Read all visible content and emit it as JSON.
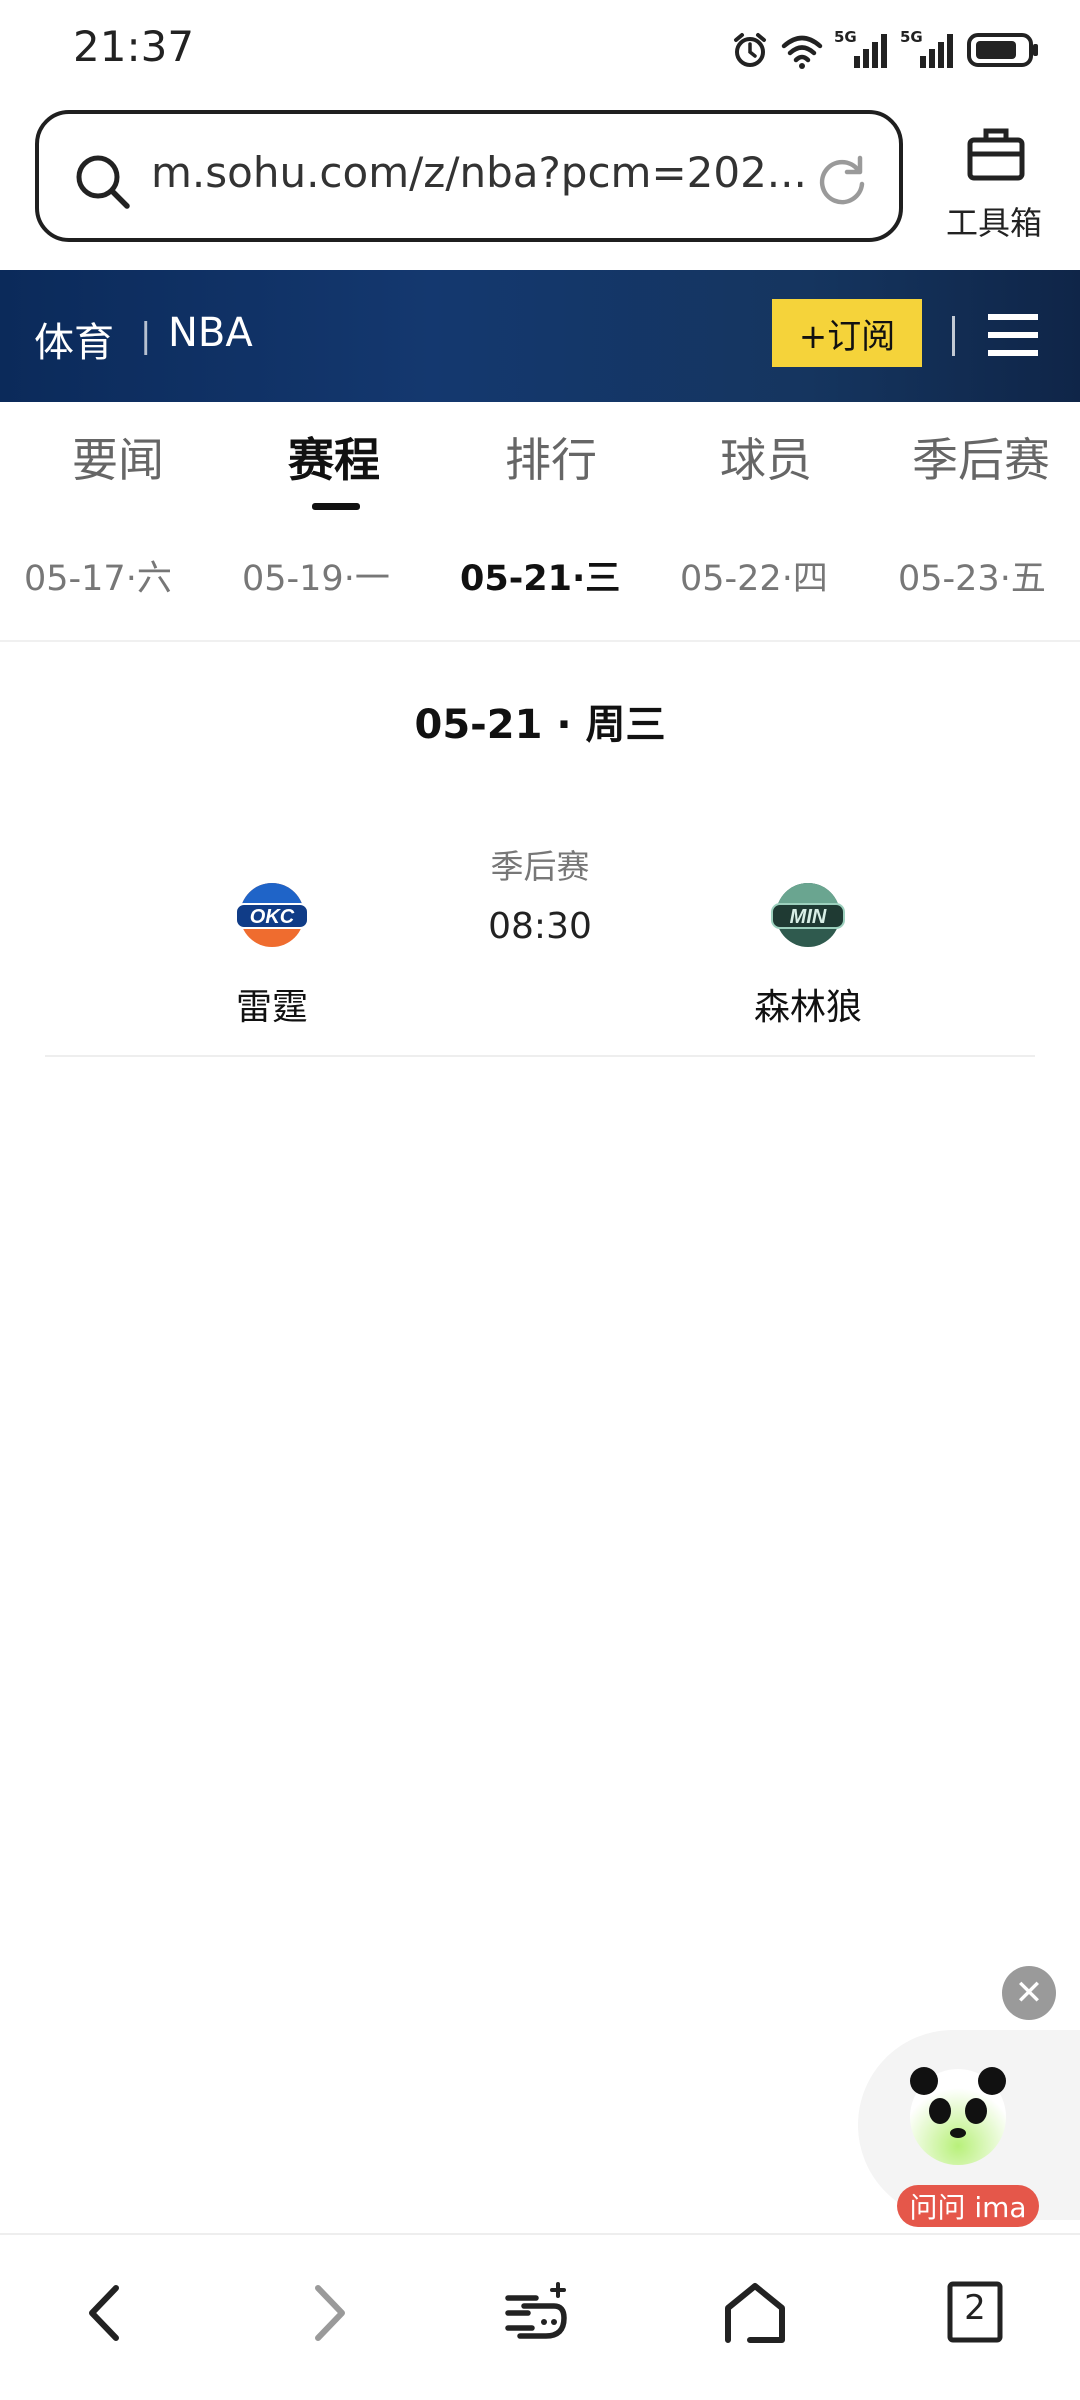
{
  "status_bar": {
    "time": "21:37",
    "icons": [
      "alarm-icon",
      "wifi-icon",
      "signal-5g-icon",
      "signal-5g-icon",
      "battery-icon"
    ],
    "network_label_1": "5G",
    "network_label_2": "5G"
  },
  "browser": {
    "url": "m.sohu.com/z/nba?pcm=202...",
    "toolbox_label": "工具箱"
  },
  "header": {
    "section": "体育",
    "separator": "|",
    "subsection": "NBA",
    "subscribe_label": "+订阅",
    "background": "#0b2a5a",
    "accent": "#f5d33a"
  },
  "tabs": [
    {
      "label": "要闻"
    },
    {
      "label": "赛程",
      "active": true
    },
    {
      "label": "排行"
    },
    {
      "label": "球员"
    },
    {
      "label": "季后赛"
    }
  ],
  "dates": [
    {
      "label": "05-17·六"
    },
    {
      "label": "05-19·一"
    },
    {
      "label": "05-21·三",
      "active": true
    },
    {
      "label": "05-22·四"
    },
    {
      "label": "05-23·五"
    }
  ],
  "schedule": {
    "day_heading": "05-21 · 周三",
    "games": [
      {
        "stage": "季后赛",
        "time": "08:30",
        "home": {
          "abbr": "OKC",
          "name": "雷霆"
        },
        "away": {
          "abbr": "MIN",
          "name": "森林狼"
        }
      }
    ]
  },
  "assistant": {
    "label": "问问 ima",
    "label_color": "#e5574a"
  },
  "bottom_nav": {
    "tab_count": "2",
    "icons": [
      "back-icon",
      "forward-icon",
      "feed-icon",
      "home-icon",
      "tabs-icon"
    ]
  }
}
